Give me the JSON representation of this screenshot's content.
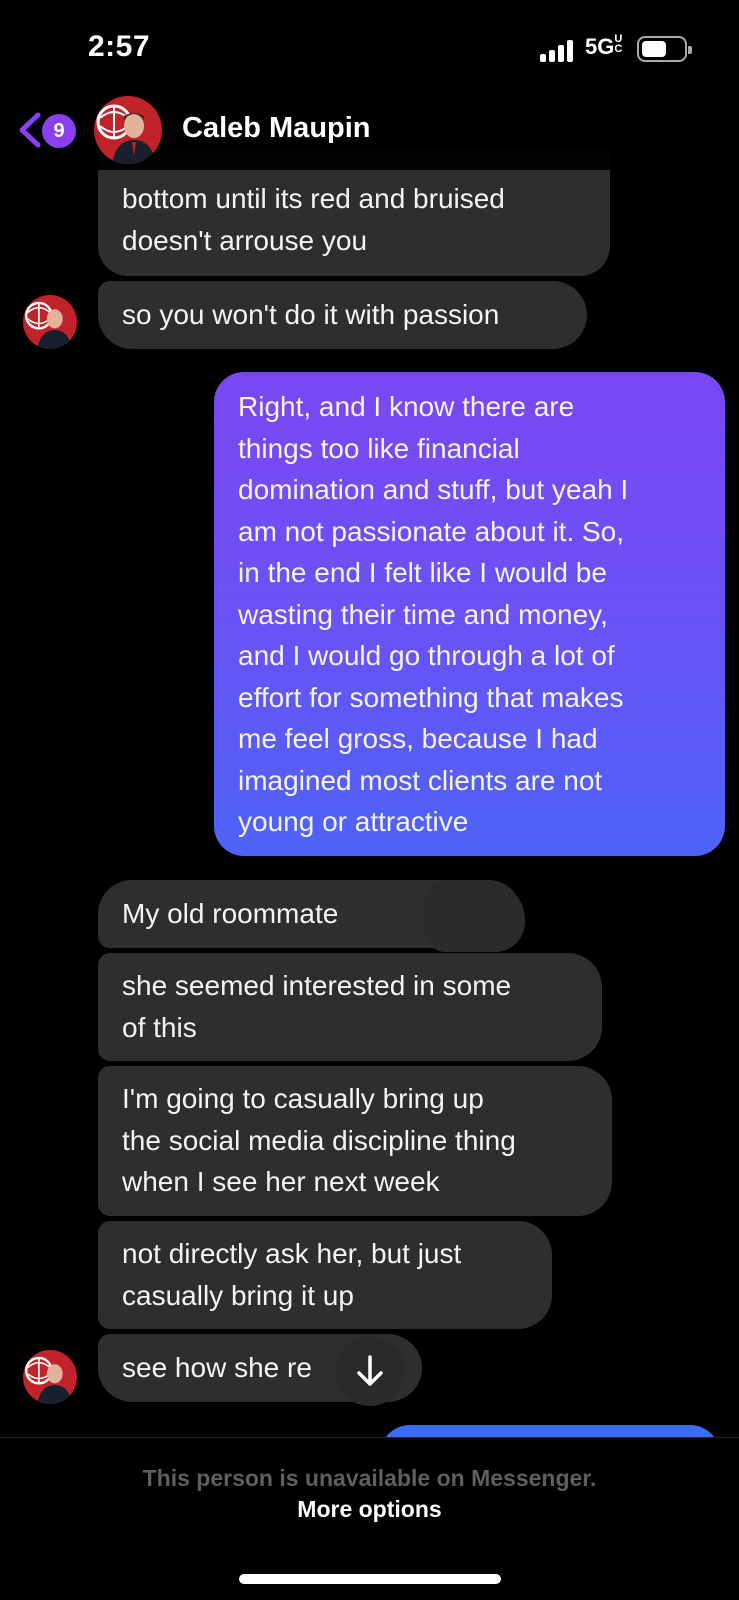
{
  "status_bar": {
    "time": "2:57",
    "network": "5G",
    "network_suffix": "UC"
  },
  "header": {
    "unread_count": "9",
    "contact_name": "Caleb Maupin",
    "back_icon": "chevron-left-icon"
  },
  "messages": [
    {
      "from": "them",
      "lines": [
        "bottom until its red and bruised",
        "doesn't arrouse you"
      ]
    },
    {
      "from": "them",
      "lines": [
        "so you won't do it with passion"
      ]
    },
    {
      "from": "me",
      "lines": [
        "Right, and I know there are",
        "things too like financial",
        "domination and stuff, but yeah I",
        "am not passionate about it. So,",
        "in the end I felt like I would be",
        "wasting their time and money,",
        "and I would go through a lot of",
        "effort for something that makes",
        "me feel gross, because I had",
        "imagined most clients are not",
        "young or attractive"
      ]
    },
    {
      "from": "them",
      "lines": [
        "My old roommate"
      ]
    },
    {
      "from": "them",
      "lines": [
        "she seemed interested in some",
        "of this"
      ]
    },
    {
      "from": "them",
      "lines": [
        "I'm going to casually bring up",
        "the social media discipline thing",
        "when I see her next week"
      ]
    },
    {
      "from": "them",
      "lines": [
        "not directly ask her, but just",
        "casually bring it up"
      ]
    },
    {
      "from": "them",
      "lines": [
        "see how she re"
      ]
    }
  ],
  "footer": {
    "notice": "This person is unavailable on Messenger.",
    "link": "More options"
  },
  "colors": {
    "accent_purple": "#8a3ff0",
    "bubble_incoming": "#2e2e2e",
    "bubble_outgoing_top": "#7b47f2",
    "bubble_outgoing_bottom": "#4e63f7"
  }
}
